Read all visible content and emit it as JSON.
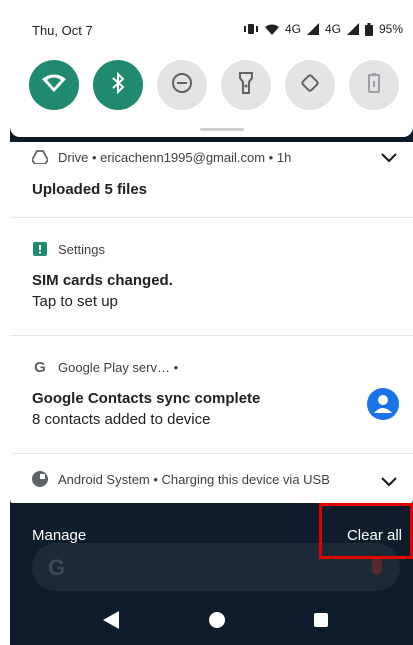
{
  "status_bar": {
    "date": "Thu, Oct 7",
    "network_1": "4G",
    "network_2": "4G",
    "battery": "95%"
  },
  "quick_settings": [
    {
      "name": "wifi",
      "on": true
    },
    {
      "name": "bluetooth",
      "on": true
    },
    {
      "name": "do-not-disturb",
      "on": false
    },
    {
      "name": "flashlight",
      "on": false
    },
    {
      "name": "auto-rotate",
      "on": false
    },
    {
      "name": "battery-saver",
      "on": false
    }
  ],
  "notifications": {
    "drive": {
      "header": "Drive • ericachenn1995@gmail.com • 1h",
      "title": "Uploaded 5 files"
    },
    "settings": {
      "header": "Settings",
      "title": "SIM cards changed.",
      "text": "Tap to set up"
    },
    "play": {
      "header": "Google Play serv… •",
      "title": "Google Contacts sync complete",
      "text": "8 contacts added to device"
    },
    "android": {
      "header": "Android System • Charging this device via USB"
    }
  },
  "footer": {
    "manage_label": "Manage",
    "clear_all_label": "Clear all"
  },
  "colors": {
    "accent": "#1f8a70",
    "highlight": "#e00000"
  }
}
